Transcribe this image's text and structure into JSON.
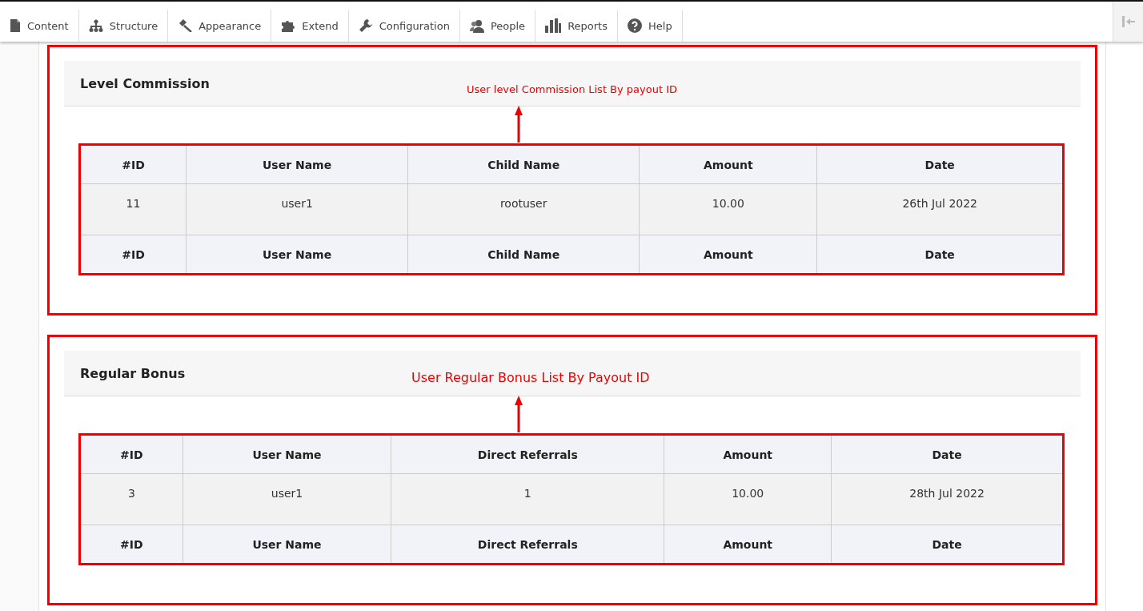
{
  "toolbar": {
    "items": [
      {
        "label": "Content"
      },
      {
        "label": "Structure"
      },
      {
        "label": "Appearance"
      },
      {
        "label": "Extend"
      },
      {
        "label": "Configuration"
      },
      {
        "label": "People"
      },
      {
        "label": "Reports"
      },
      {
        "label": "Help"
      }
    ]
  },
  "sections": [
    {
      "title": "Level Commission",
      "annotation": "User level Commission List By payout ID",
      "columns": [
        "#ID",
        "User Name",
        "Child Name",
        "Amount",
        "Date"
      ],
      "rows": [
        [
          "11",
          "user1",
          "rootuser",
          "10.00",
          "26th Jul 2022"
        ]
      ],
      "footer": [
        "#ID",
        "User Name",
        "Child Name",
        "Amount",
        "Date"
      ]
    },
    {
      "title": "Regular Bonus",
      "annotation": "User Regular Bonus List By Payout ID",
      "columns": [
        "#ID",
        "User Name",
        "Direct Referrals",
        "Amount",
        "Date"
      ],
      "rows": [
        [
          "3",
          "user1",
          "1",
          "10.00",
          "28th Jul 2022"
        ]
      ],
      "footer": [
        "#ID",
        "User Name",
        "Direct Referrals",
        "Amount",
        "Date"
      ]
    }
  ]
}
